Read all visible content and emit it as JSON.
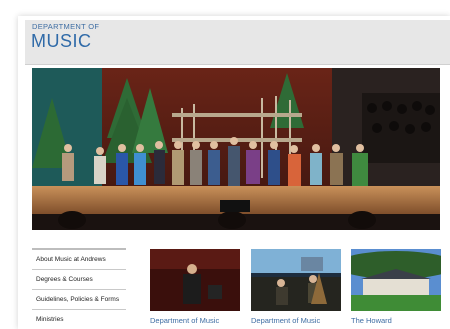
{
  "header": {
    "department_label": "DEPARTMENT OF",
    "title": "MUSIC"
  },
  "hero": {
    "image": "stage-performance-curtain-call-icon"
  },
  "sidebar": {
    "items": [
      {
        "label": "About Music at Andrews"
      },
      {
        "label": "Degrees & Courses"
      },
      {
        "label": "Guidelines, Policies & Forms"
      },
      {
        "label": "Ministries"
      }
    ]
  },
  "features": [
    {
      "caption": "Department of Music",
      "image": "conductor-photo-icon"
    },
    {
      "caption": "Department of Music",
      "image": "instrument-ensemble-photo-icon"
    },
    {
      "caption": "The Howard",
      "image": "building-photo-icon"
    }
  ]
}
